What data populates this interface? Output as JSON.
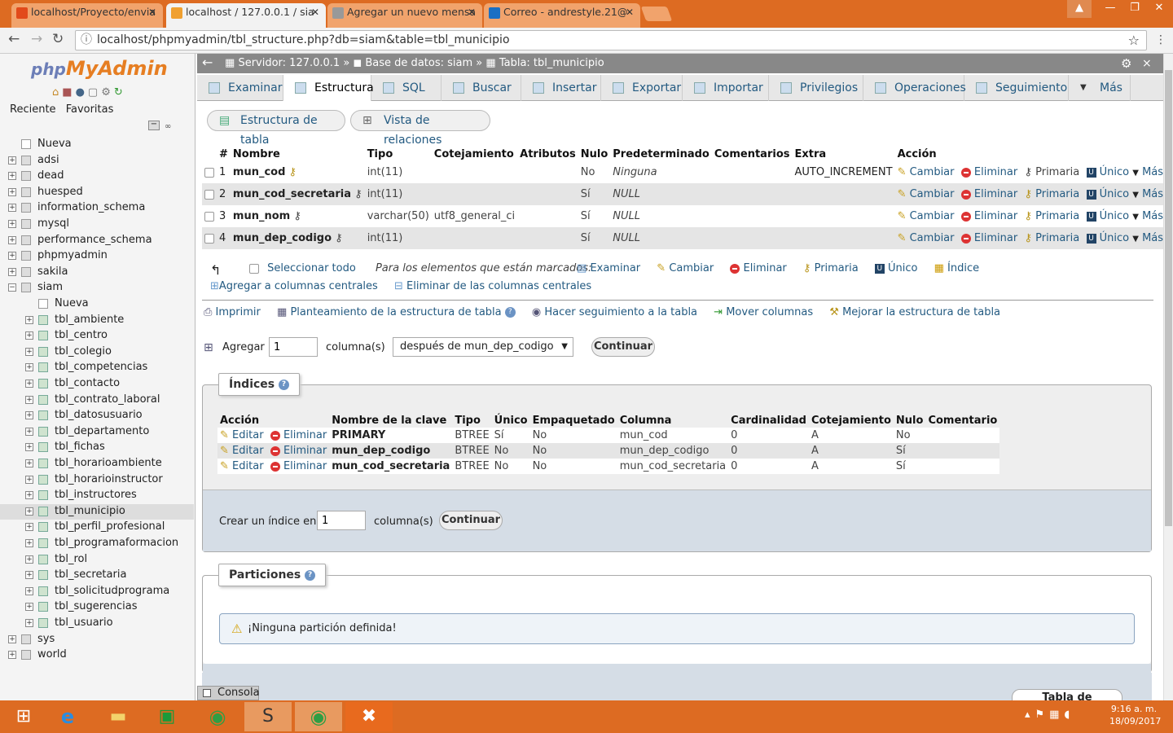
{
  "browser": {
    "tabs": [
      {
        "label": "localhost/Proyecto/envia"
      },
      {
        "label": "localhost / 127.0.0.1 / sia"
      },
      {
        "label": "Agregar un nuevo mensa"
      },
      {
        "label": "Correo - andrestyle.21@"
      }
    ],
    "url": "localhost/phpmyadmin/tbl_structure.php?db=siam&table=tbl_municipio"
  },
  "sidebar": {
    "logo_php": "php",
    "logo_admin": "MyAdmin",
    "tabs": [
      "Reciente",
      "Favoritas"
    ],
    "new_label": "Nueva",
    "databases": [
      "adsi",
      "dead",
      "huesped",
      "information_schema",
      "mysql",
      "performance_schema",
      "phpmyadmin",
      "sakila",
      "siam"
    ],
    "siam_new": "Nueva",
    "siam_tables": [
      "tbl_ambiente",
      "tbl_centro",
      "tbl_colegio",
      "tbl_competencias",
      "tbl_contacto",
      "tbl_contrato_laboral",
      "tbl_datosusuario",
      "tbl_departamento",
      "tbl_fichas",
      "tbl_horarioambiente",
      "tbl_horarioinstructor",
      "tbl_instructores",
      "tbl_municipio",
      "tbl_perfil_profesional",
      "tbl_programaformacion",
      "tbl_rol",
      "tbl_secretaria",
      "tbl_solicitudprograma",
      "tbl_sugerencias",
      "tbl_usuario"
    ],
    "databases_after": [
      "sys",
      "world"
    ]
  },
  "breadcrumb": {
    "server": "Servidor: 127.0.0.1",
    "db": "Base de datos: siam",
    "table": "Tabla: tbl_municipio",
    "sep": "»"
  },
  "topnav": [
    "Examinar",
    "Estructura",
    "SQL",
    "Buscar",
    "Insertar",
    "Exportar",
    "Importar",
    "Privilegios",
    "Operaciones",
    "Seguimiento",
    "Más"
  ],
  "subtabs": [
    "Estructura de tabla",
    "Vista de relaciones"
  ],
  "structure": {
    "headers": [
      "#",
      "Nombre",
      "Tipo",
      "Cotejamiento",
      "Atributos",
      "Nulo",
      "Predeterminado",
      "Comentarios",
      "Extra",
      "Acción"
    ],
    "rows": [
      {
        "n": "1",
        "name": "mun_cod",
        "type": "int(11)",
        "coll": "",
        "null": "No",
        "def": "Ninguna",
        "extra": "AUTO_INCREMENT"
      },
      {
        "n": "2",
        "name": "mun_cod_secretaria",
        "type": "int(11)",
        "coll": "",
        "null": "Sí",
        "def": "NULL",
        "extra": ""
      },
      {
        "n": "3",
        "name": "mun_nom",
        "type": "varchar(50)",
        "coll": "utf8_general_ci",
        "null": "Sí",
        "def": "NULL",
        "extra": ""
      },
      {
        "n": "4",
        "name": "mun_dep_codigo",
        "type": "int(11)",
        "coll": "",
        "null": "Sí",
        "def": "NULL",
        "extra": ""
      }
    ],
    "actions": [
      "Cambiar",
      "Eliminar",
      "Primaria",
      "Único",
      "Más"
    ]
  },
  "bulk": {
    "select_all": "Seleccionar todo",
    "for_selected": "Para los elementos que están marcados:",
    "actions": [
      "Examinar",
      "Cambiar",
      "Eliminar",
      "Primaria",
      "Único",
      "Índice"
    ],
    "central_add": "Agregar a columnas centrales",
    "central_remove": "Eliminar de las columnas centrales"
  },
  "links": [
    "Imprimir",
    "Planteamiento de la estructura de tabla",
    "Hacer seguimiento a la tabla",
    "Mover columnas",
    "Mejorar la estructura de tabla"
  ],
  "add_columns": {
    "label": "Agregar",
    "value": "1",
    "unit": "columna(s)",
    "position": "después de mun_dep_codigo",
    "button": "Continuar"
  },
  "indexes": {
    "legend": "Índices",
    "headers": [
      "Acción",
      "Nombre de la clave",
      "Tipo",
      "Único",
      "Empaquetado",
      "Columna",
      "Cardinalidad",
      "Cotejamiento",
      "Nulo",
      "Comentario"
    ],
    "edit": "Editar",
    "delete": "Eliminar",
    "rows": [
      {
        "key": "PRIMARY",
        "type": "BTREE",
        "unique": "Sí",
        "packed": "No",
        "col": "mun_cod",
        "card": "0",
        "coll": "A",
        "null": "No"
      },
      {
        "key": "mun_dep_codigo",
        "type": "BTREE",
        "unique": "No",
        "packed": "No",
        "col": "mun_dep_codigo",
        "card": "0",
        "coll": "A",
        "null": "Sí"
      },
      {
        "key": "mun_cod_secretaria",
        "type": "BTREE",
        "unique": "No",
        "packed": "No",
        "col": "mun_cod_secretaria",
        "card": "0",
        "coll": "A",
        "null": "Sí"
      }
    ],
    "create_label": "Crear un índice en",
    "create_value": "1",
    "create_unit": "columna(s)",
    "create_button": "Continuar"
  },
  "partitions": {
    "legend": "Particiones",
    "message": "¡Ninguna partición definida!"
  },
  "console": "Consola",
  "divisions": "Tabla de divisiones",
  "clock": {
    "time": "9:16 a. m.",
    "date": "18/09/2017"
  }
}
